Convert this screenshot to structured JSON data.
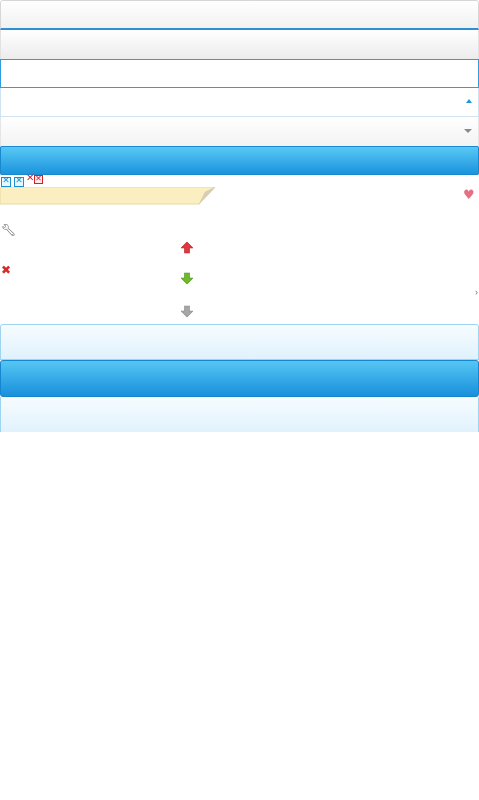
{
  "icons": {
    "caret_up": "caret-up-icon",
    "caret_down": "caret-down-icon",
    "close": "close-box-icon",
    "delete": "delete-x-icon",
    "favorite": "heart-icon",
    "settings": "wrench-icon",
    "sort_up": "arrow-up-icon",
    "sort_down": "arrow-down-icon",
    "sort_none": "arrow-down-disabled-icon"
  },
  "colors": {
    "accent": "#1b94de",
    "accent_light": "#58c8f4",
    "note_bg": "#fbefc2",
    "arrow_up": "#e0383f",
    "arrow_down": "#6dba2a",
    "arrow_disabled": "#9a9a9a",
    "danger": "#d2202c"
  }
}
